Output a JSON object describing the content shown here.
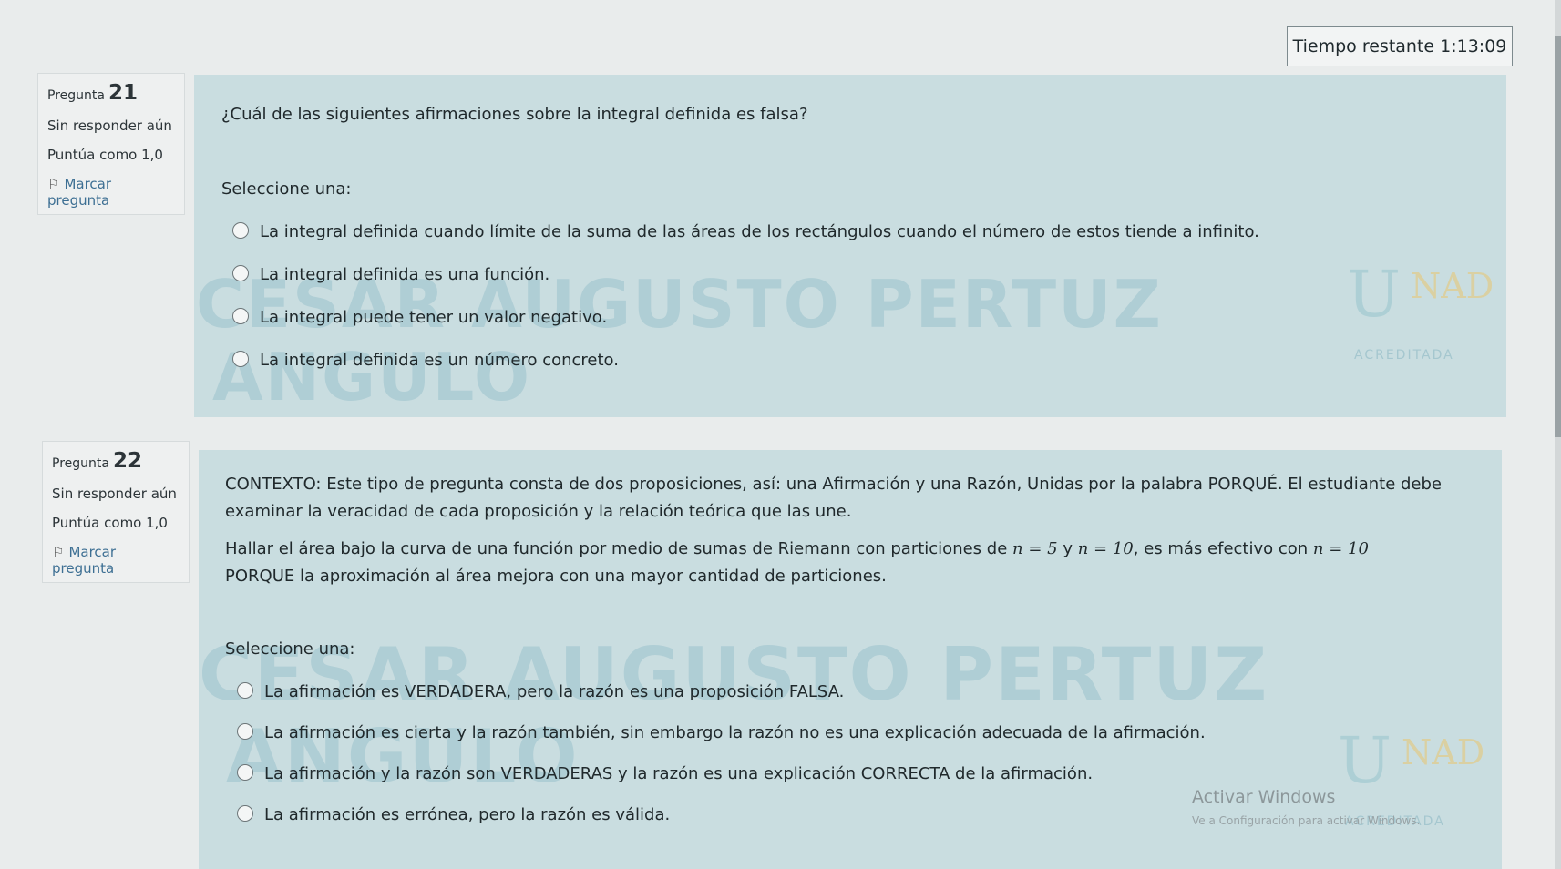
{
  "timer": {
    "label": "Tiempo restante",
    "value": "1:13:09"
  },
  "q21": {
    "info": {
      "label": "Pregunta",
      "number": "21",
      "status": "Sin responder aún",
      "points": "Puntúa como 1,0",
      "flag": "Marcar pregunta"
    },
    "question": "¿Cuál de las siguientes afirmaciones sobre la integral definida es falsa?",
    "prompt": "Seleccione una:",
    "options": [
      "La integral definida cuando límite de la suma de las áreas de los rectángulos cuando el número de estos tiende a infinito.",
      "La integral definida es una función.",
      "La integral puede tener un valor negativo.",
      "La integral definida es un número concreto."
    ]
  },
  "q22": {
    "info": {
      "label": "Pregunta",
      "number": "22",
      "status": "Sin responder aún",
      "points": "Puntúa como 1,0",
      "flag": "Marcar pregunta"
    },
    "context_line1": "CONTEXTO: Este tipo de pregunta consta de dos proposiciones, así: una Afirmación y una Razón, Unidas por la palabra PORQUÉ. El estudiante debe",
    "context_line2": "examinar la veracidad de cada proposición y la relación teórica que las une.",
    "statement_part1": "Hallar el área bajo la curva de una función por medio de sumas de Riemann con particiones de",
    "math1": "n = 5",
    "statement_y": "y",
    "math2": "n = 10",
    "statement_part2": ", es más efectivo con",
    "math3": "n = 10",
    "statement_line2": "PORQUE la aproximación al área mejora con una mayor cantidad de particiones.",
    "prompt": "Seleccione una:",
    "options": [
      "La afirmación es VERDADERA, pero la razón es una proposición FALSA.",
      "La afirmación es cierta y la razón también, sin embargo la razón no es una explicación adecuada de la afirmación.",
      "La afirmación y la razón son VERDADERAS y la razón es una explicación CORRECTA de la afirmación.",
      "La afirmación es errónea, pero la razón es válida."
    ]
  },
  "watermark": {
    "top": "CESAR AUGUSTO PERTUZ",
    "bottom": "ANGULO"
  },
  "logo": {
    "letters": "UNAD",
    "accredited": "ACREDITADA"
  },
  "windows": {
    "title": "Activar Windows",
    "subtitle": "Ve a Configuración para activar Windows."
  }
}
